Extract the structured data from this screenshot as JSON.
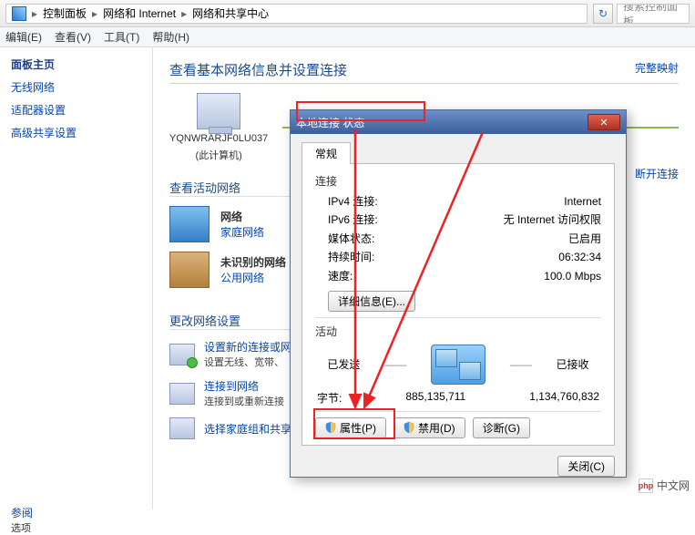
{
  "breadcrumb": {
    "items": [
      "控制面板",
      "网络和 Internet",
      "网络和共享中心"
    ],
    "search_placeholder": "搜索控制面板"
  },
  "menu": {
    "items": [
      "编辑(E)",
      "查看(V)",
      "工具(T)",
      "帮助(H)"
    ]
  },
  "sidebar": {
    "title": "面板主页",
    "links": [
      "无线网络",
      "适配器设置",
      "高级共享设置"
    ],
    "bottom_label": "参阅",
    "bottom_item": "选项"
  },
  "content": {
    "heading": "查看基本网络信息并设置连接",
    "topo_computer": "YQNWRARJF0LU037",
    "topo_computer_sub": "(此计算机)",
    "right_link_1": "完整映射",
    "right_link_2": "断开连接",
    "section_active": "查看活动网络",
    "net1_name": "网络",
    "net1_sub": "家庭网络",
    "net2_name": "未识别的网络",
    "net2_sub": "公用网络",
    "section_settings": "更改网络设置",
    "setting1_title": "设置新的连接或网络",
    "setting1_desc": "设置无线、宽带、",
    "setting2_title": "连接到网络",
    "setting2_desc": "连接到或重新连接",
    "setting3_title": "选择家庭组和共享选项"
  },
  "dialog": {
    "title": "本地连接 状态",
    "tab": "常规",
    "group_connection": "连接",
    "rows": [
      {
        "k": "IPv4 连接:",
        "v": "Internet"
      },
      {
        "k": "IPv6 连接:",
        "v": "无 Internet 访问权限"
      },
      {
        "k": "媒体状态:",
        "v": "已启用"
      },
      {
        "k": "持续时间:",
        "v": "06:32:34"
      },
      {
        "k": "速度:",
        "v": "100.0 Mbps"
      }
    ],
    "details_btn": "详细信息(E)...",
    "group_activity": "活动",
    "sent_label": "已发送",
    "recv_label": "已接收",
    "bytes_label": "字节:",
    "bytes_sent": "885,135,711",
    "bytes_recv": "1,134,760,832",
    "btn_properties": "属性(P)",
    "btn_disable": "禁用(D)",
    "btn_diagnose": "诊断(G)",
    "btn_close": "关闭(C)"
  },
  "watermark": "中文网"
}
